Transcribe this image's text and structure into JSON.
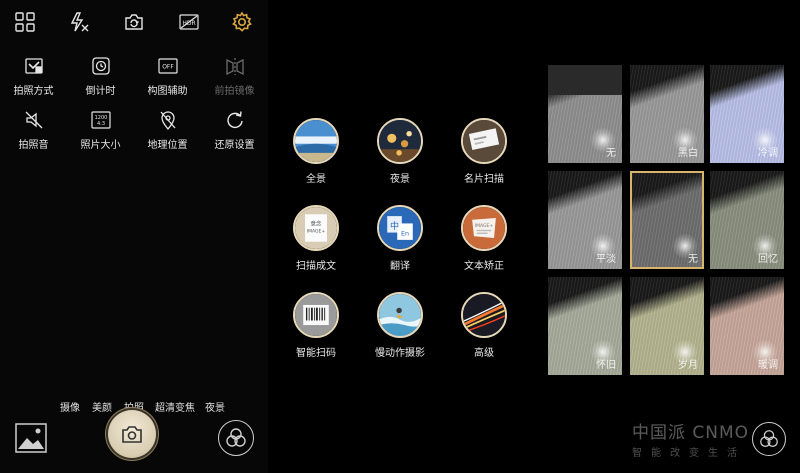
{
  "topbar": {
    "icons": [
      "grid-icon",
      "flash-off-icon",
      "switch-camera-icon",
      "hdr-icon",
      "settings-gear-icon"
    ],
    "accent": "#d9a640"
  },
  "settings": {
    "row1": [
      {
        "label": "拍照方式",
        "icon": "capture-mode-icon"
      },
      {
        "label": "倒计时",
        "icon": "timer-icon"
      },
      {
        "label": "构图辅助",
        "icon": "grid-assist-icon"
      },
      {
        "label": "前拍镜像",
        "icon": "mirror-icon"
      }
    ],
    "row2": [
      {
        "label": "拍照音",
        "icon": "shutter-sound-off-icon"
      },
      {
        "label": "照片大小",
        "icon": "resolution-icon"
      },
      {
        "label": "地理位置",
        "icon": "location-off-icon"
      },
      {
        "label": "还原设置",
        "icon": "reset-icon"
      }
    ],
    "off_text": "OFF",
    "res_text_top": "1200",
    "res_text_bottom": "4:3"
  },
  "mode_strip": [
    "摄像",
    "美颜",
    "拍照",
    "超清变焦",
    "夜景"
  ],
  "modes": [
    {
      "label": "全景",
      "icon": "panorama-icon"
    },
    {
      "label": "夜景",
      "icon": "night-icon"
    },
    {
      "label": "名片扫描",
      "icon": "card-scan-icon"
    },
    {
      "label": "扫描成文",
      "icon": "doc-scan-icon"
    },
    {
      "label": "翻译",
      "icon": "translate-icon"
    },
    {
      "label": "文本矫正",
      "icon": "text-correct-icon"
    },
    {
      "label": "智能扫码",
      "icon": "barcode-icon"
    },
    {
      "label": "慢动作摄影",
      "icon": "slow-motion-icon"
    },
    {
      "label": "高级",
      "icon": "advanced-icon"
    }
  ],
  "translate_glyphs": {
    "zh": "中",
    "en": "En"
  },
  "doc_scan_text": {
    "line1": "意念",
    "line2": "IMAGE+"
  },
  "text_correct_text": "IMAGE+",
  "filters": [
    {
      "label": "无",
      "tone": "#8f8f8f"
    },
    {
      "label": "黑白",
      "tone": "#9a9a9a"
    },
    {
      "label": "冷调",
      "tone": "#b9c0e8"
    },
    {
      "label": "平淡",
      "tone": "#9a9a9a"
    },
    {
      "label": "无",
      "tone": "#6e6e6e",
      "selected": true
    },
    {
      "label": "回忆",
      "tone": "#8a8f7e"
    },
    {
      "label": "怀旧",
      "tone": "#a6ab9a"
    },
    {
      "label": "岁月",
      "tone": "#b4b48f"
    },
    {
      "label": "暖调",
      "tone": "#c7a79a"
    }
  ],
  "watermark": {
    "brand": "中国派 CNMO",
    "sub": "智能改变生活"
  }
}
